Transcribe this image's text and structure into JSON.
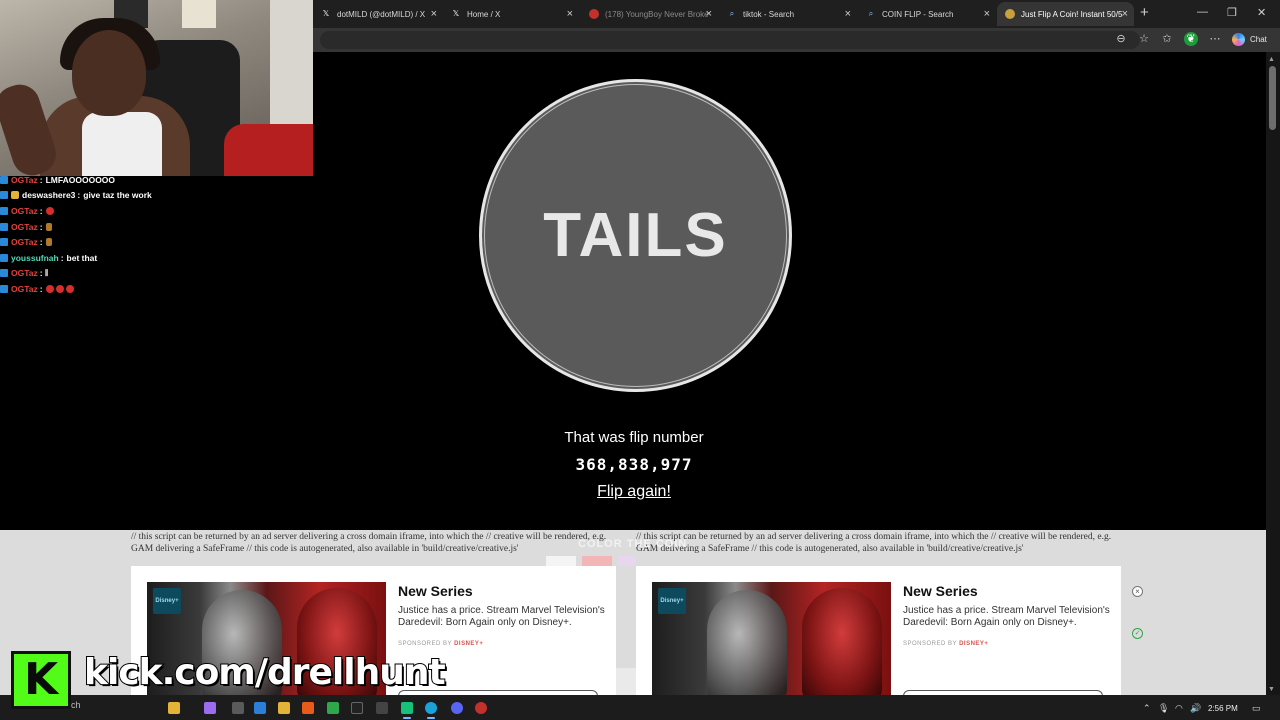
{
  "browser": {
    "tabs": [
      {
        "label": "dotMILD (@dotMILD) / X",
        "icon": "x-logo-icon"
      },
      {
        "label": "Home / X",
        "icon": "x-logo-icon"
      },
      {
        "label": "(178) YoungBoy Never Broke",
        "icon": "youtube-icon"
      },
      {
        "label": "tiktok - Search",
        "icon": "search-icon"
      },
      {
        "label": "COIN FLIP - Search",
        "icon": "search-icon"
      },
      {
        "label": "Just Flip A Coin! Instant 50/5",
        "icon": "coin-icon",
        "active": true
      }
    ],
    "new_tab": "+",
    "chat_label": "Chat",
    "window_controls": {
      "minimize": "—",
      "restore": "❐",
      "close": "✕"
    }
  },
  "coin": {
    "result": "TAILS",
    "flip_label": "That was flip number",
    "flip_count": "368,838,977",
    "flip_again": "Flip again!"
  },
  "ads": {
    "script_text": "// this script can be returned by an ad server delivering a cross domain iframe, into which the // creative will be rendered, e.g. GAM delivering a SafeFrame // this code is autogenerated, also available in 'build/creative/creative.js'",
    "color_the_coin": "COLOR THE COIN",
    "cards": [
      {
        "title": "New Series",
        "body": "Justice has a price. Stream Marvel Television's Daredevil: Born Again only on Disney+.",
        "sponsor_prefix": "SPONSORED BY",
        "sponsor": "DISNEY+",
        "badge": "Disney+"
      },
      {
        "title": "New Series",
        "body": "Justice has a price. Stream Marvel Television's Daredevil: Born Again only on Disney+.",
        "sponsor_prefix": "SPONSORED BY",
        "sponsor": "DISNEY+",
        "badge": "Disney+"
      }
    ],
    "close_icon": "×",
    "info_icon": "✓"
  },
  "stream": {
    "chat": [
      {
        "user": "OGTaz",
        "msg": "LMFAOOOOOOO",
        "user_color": "#e2413a"
      },
      {
        "user": "deswashere3",
        "msg": "give taz the work",
        "user_color": "#ffffff"
      },
      {
        "user": "OGTaz",
        "msg": "",
        "user_color": "#e2413a",
        "emotes": 1
      },
      {
        "user": "OGTaz",
        "msg": "",
        "user_color": "#e2413a",
        "small_emotes": 1
      },
      {
        "user": "OGTaz",
        "msg": "",
        "user_color": "#e2413a",
        "small_emotes": 1
      },
      {
        "user": "youssufnah",
        "msg": "bet that",
        "user_color": "#53d8b4"
      },
      {
        "user": "OGTaz",
        "msg": "𝄃",
        "user_color": "#e2413a"
      },
      {
        "user": "OGTaz",
        "msg": "",
        "user_color": "#e2413a",
        "emotes": 3
      }
    ],
    "kick_letter": "K",
    "kick_url": "kick.com/drellhunt"
  },
  "taskbar": {
    "search": "Search",
    "time": "2:56 PM"
  }
}
